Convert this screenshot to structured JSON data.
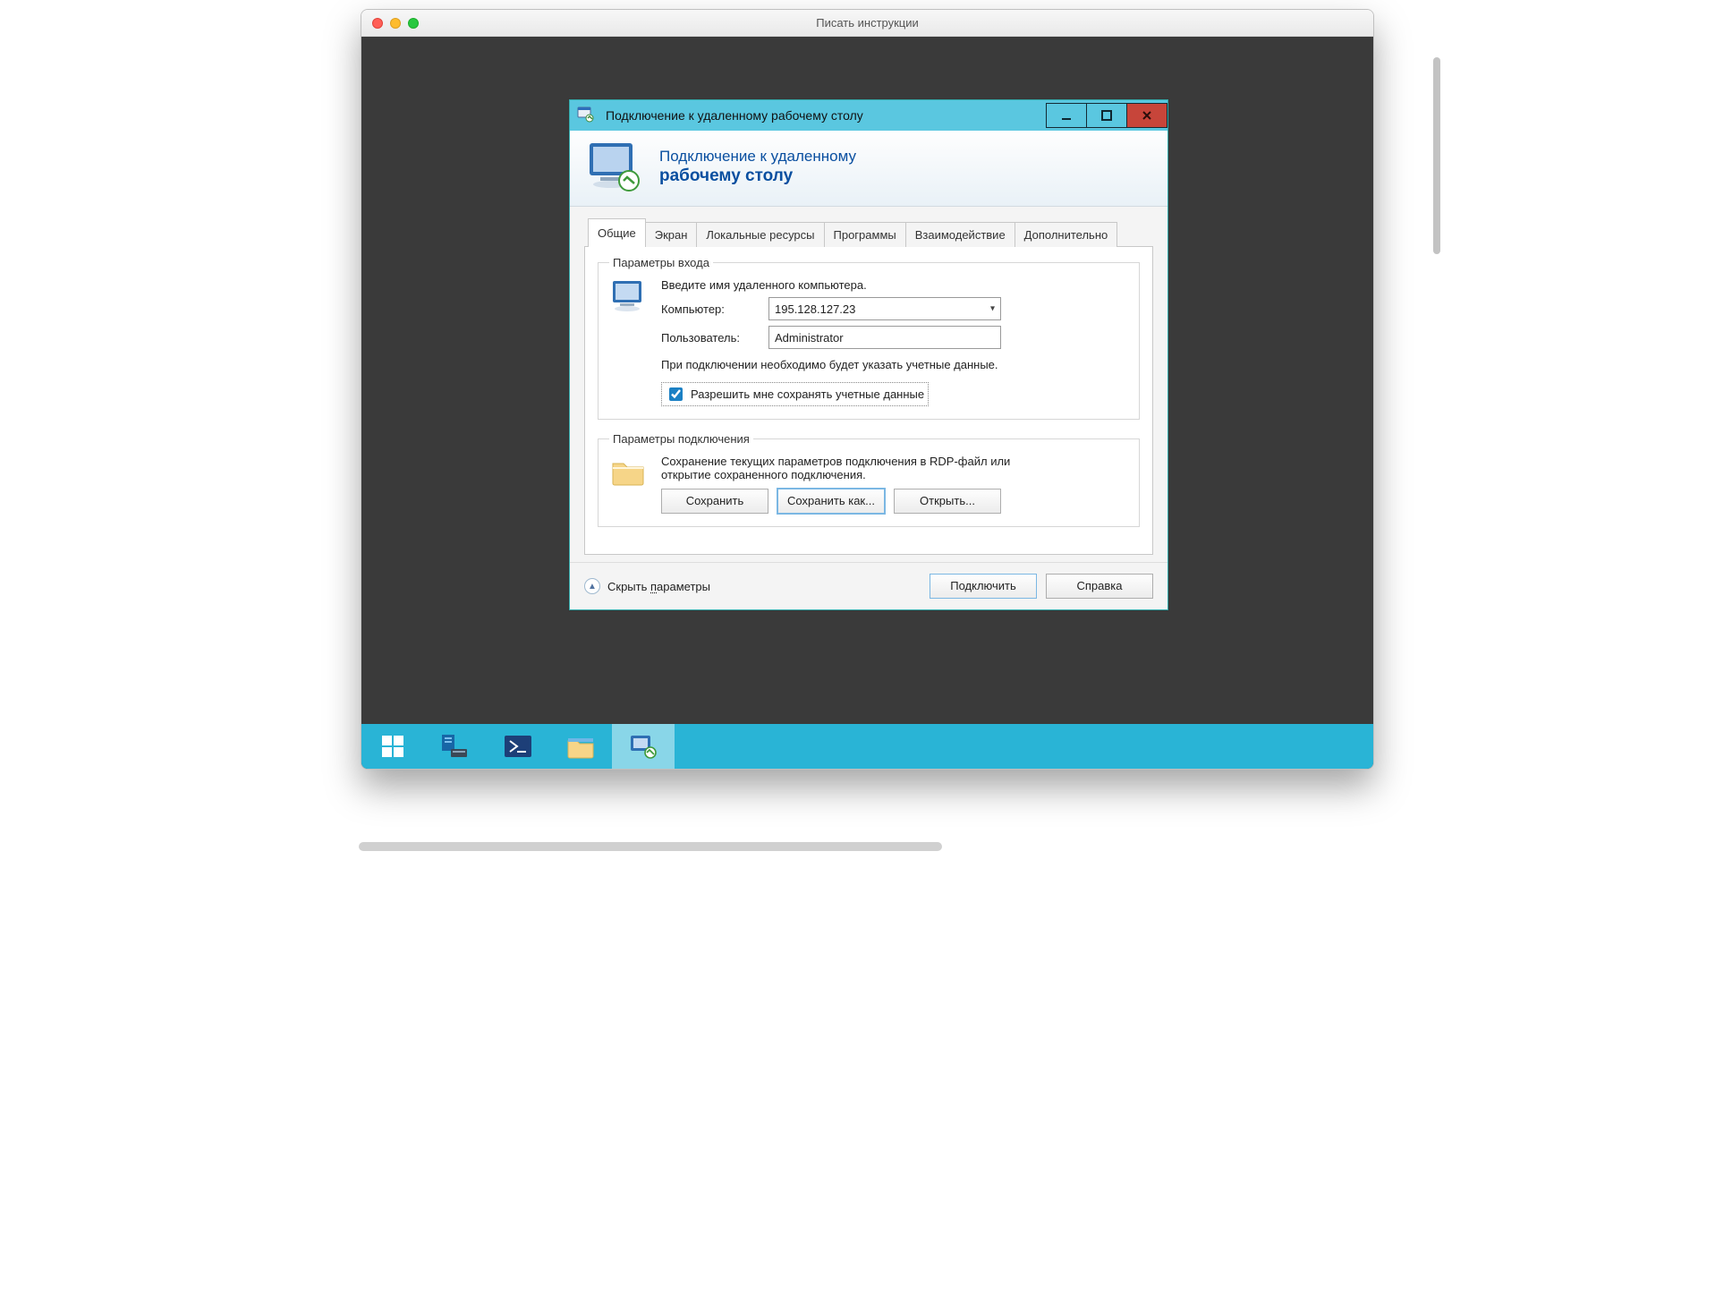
{
  "mac": {
    "title": "Писать инструкции"
  },
  "rdp": {
    "window_title": "Подключение к удаленному рабочему столу",
    "header_line1": "Подключение к удаленному",
    "header_line2": "рабочему столу",
    "tabs": {
      "general": "Общие",
      "display": "Экран",
      "local": "Локальные ресурсы",
      "programs": "Программы",
      "experience": "Взаимодействие",
      "advanced": "Дополнительно"
    },
    "login": {
      "legend": "Параметры входа",
      "intro": "Введите имя удаленного компьютера.",
      "computer_label": "Компьютер:",
      "computer_value": "195.128.127.23",
      "user_label": "Пользователь:",
      "user_value": "Administrator",
      "note": "При подключении необходимо будет указать учетные данные.",
      "save_creds": "Разрешить мне сохранять учетные данные"
    },
    "connection": {
      "legend": "Параметры подключения",
      "desc": "Сохранение текущих параметров подключения в RDP-файл или открытие сохраненного подключения.",
      "save": "Сохранить",
      "save_as": "Сохранить как...",
      "open": "Открыть..."
    },
    "footer": {
      "hide": "Скрыть параметры",
      "hide_hotkey_pre": "Скрыть ",
      "hide_hotkey_u": "п",
      "hide_hotkey_post": "араметры",
      "connect": "Подключить",
      "help": "Справка"
    }
  }
}
